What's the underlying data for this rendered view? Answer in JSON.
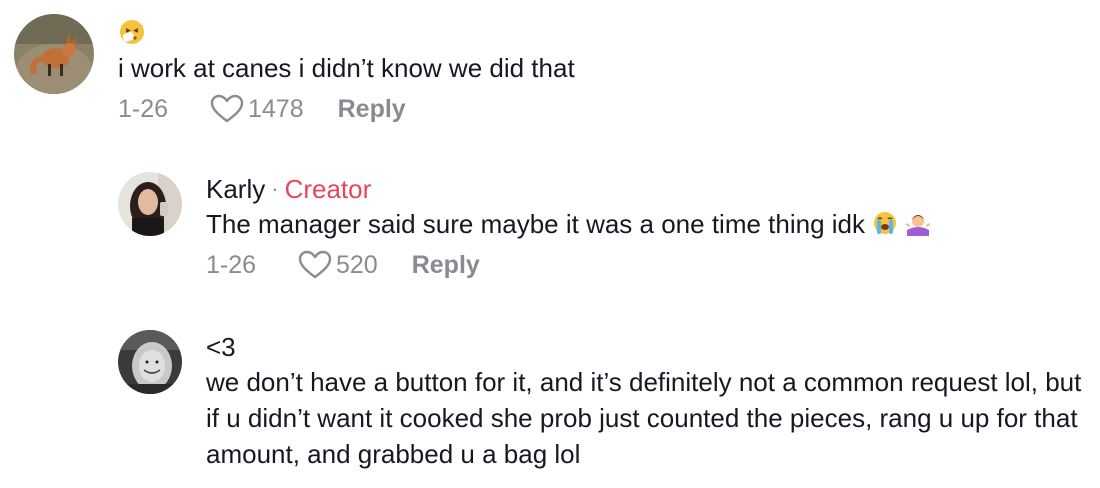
{
  "comments": [
    {
      "text_emoji": "sneezing-face-emoji",
      "text": "i work at canes i didn’t know we did that",
      "date": "1-26",
      "likes": "1478",
      "reply_label": "Reply"
    },
    {
      "username": "Karly",
      "separator": "·",
      "badge": "Creator",
      "text": "The manager said sure maybe it was a one time thing idk",
      "trailing_emojis": [
        "loudly-crying-face-emoji",
        "person-shrugging-emoji"
      ],
      "date": "1-26",
      "likes": "520",
      "reply_label": "Reply"
    },
    {
      "username": "<3",
      "text": "we don’t have a button for it, and it’s definitely not a common request lol, but if u didn’t want it cooked she prob just counted the pieces, rang u up for that amount, and grabbed u a bag lol"
    }
  ],
  "colors": {
    "text": "#161823",
    "meta": "#8a8b91",
    "creator": "#e8465f"
  }
}
